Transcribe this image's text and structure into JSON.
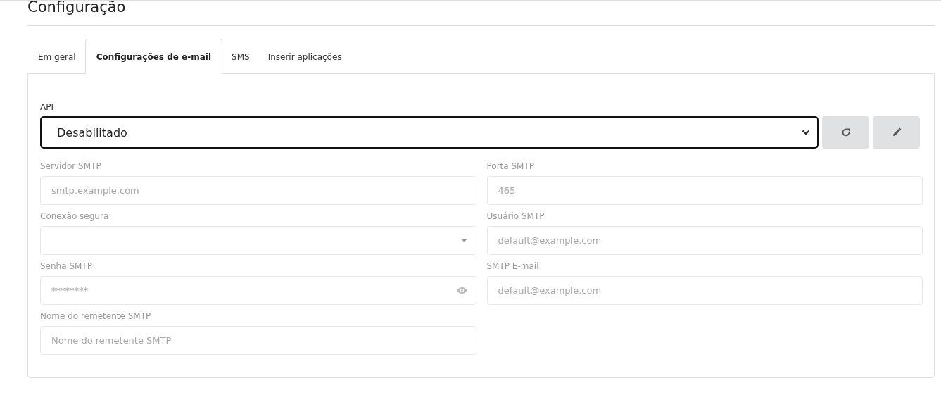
{
  "title": "Configuração",
  "tabs": [
    {
      "label": "Em geral",
      "selected": false
    },
    {
      "label": "Configurações de e-mail",
      "selected": true
    },
    {
      "label": "SMS",
      "selected": false
    },
    {
      "label": "Inserir aplicações",
      "selected": false
    }
  ],
  "api": {
    "label": "API",
    "value": "Desabilitado"
  },
  "fields": [
    {
      "kind": "input",
      "label": "Servidor SMTP",
      "placeholder": "smtp.example.com",
      "disabled": true
    },
    {
      "kind": "input",
      "label": "Porta SMTP",
      "placeholder": "465",
      "disabled": true
    },
    {
      "kind": "select",
      "label": "Conexão segura",
      "disabled": true
    },
    {
      "kind": "input",
      "label": "Usuário SMTP",
      "placeholder": "default@example.com",
      "disabled": true
    },
    {
      "kind": "password",
      "label": "Senha SMTP",
      "placeholder": "********",
      "disabled": true
    },
    {
      "kind": "input",
      "label": "SMTP E-mail",
      "placeholder": "default@example.com",
      "disabled": true
    },
    {
      "kind": "input",
      "label": "Nome do remetente SMTP",
      "placeholder": "Nome do remetente SMTP",
      "disabled": true
    }
  ]
}
